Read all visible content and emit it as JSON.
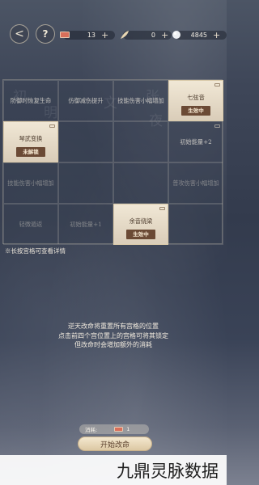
{
  "top_bar": {
    "share_icon": "share-icon",
    "help_label": "?",
    "resources": [
      {
        "name": "scroll",
        "value": "13",
        "plus": "+"
      },
      {
        "name": "feather",
        "value": "0",
        "plus": "+"
      },
      {
        "name": "pearl",
        "value": "4845",
        "plus": "+"
      }
    ]
  },
  "grid": {
    "cells": [
      {
        "label": "防御时恢复生命",
        "active": false,
        "tag": ""
      },
      {
        "label": "仿御减伤提升",
        "active": false,
        "tag": ""
      },
      {
        "label": "技能伤害小幅增加",
        "active": false,
        "tag": ""
      },
      {
        "label": "七弦音",
        "active": true,
        "tag": "生效中"
      },
      {
        "label": "琴武变换",
        "active": true,
        "tag": "未解锁"
      },
      {
        "label": "",
        "active": false,
        "tag": ""
      },
      {
        "label": "",
        "active": false,
        "tag": ""
      },
      {
        "label": "初始能量+2",
        "active": false,
        "tag": ""
      },
      {
        "label": "技能伤害小幅增加",
        "active": false,
        "tag": ""
      },
      {
        "label": "",
        "active": false,
        "tag": ""
      },
      {
        "label": "",
        "active": false,
        "tag": ""
      },
      {
        "label": "普攻伤害小幅增加",
        "active": false,
        "tag": ""
      },
      {
        "label": "轻微遁返",
        "active": false,
        "tag": ""
      },
      {
        "label": "初始能量+1",
        "active": false,
        "tag": ""
      },
      {
        "label": "余音绕梁",
        "active": true,
        "tag": "生效中"
      },
      {
        "label": "",
        "active": false,
        "tag": ""
      }
    ]
  },
  "hint": "※长按宫格可查看详情",
  "description": [
    "逆天改命将重置所有宫格的位置",
    "点击前四个宫位置上的宫格可将其锁定",
    "但改命时会增加额外的消耗"
  ],
  "cost": {
    "label": "消耗:",
    "value": "1"
  },
  "start_button": "开始改命",
  "watermark": "九鼎灵脉数据"
}
